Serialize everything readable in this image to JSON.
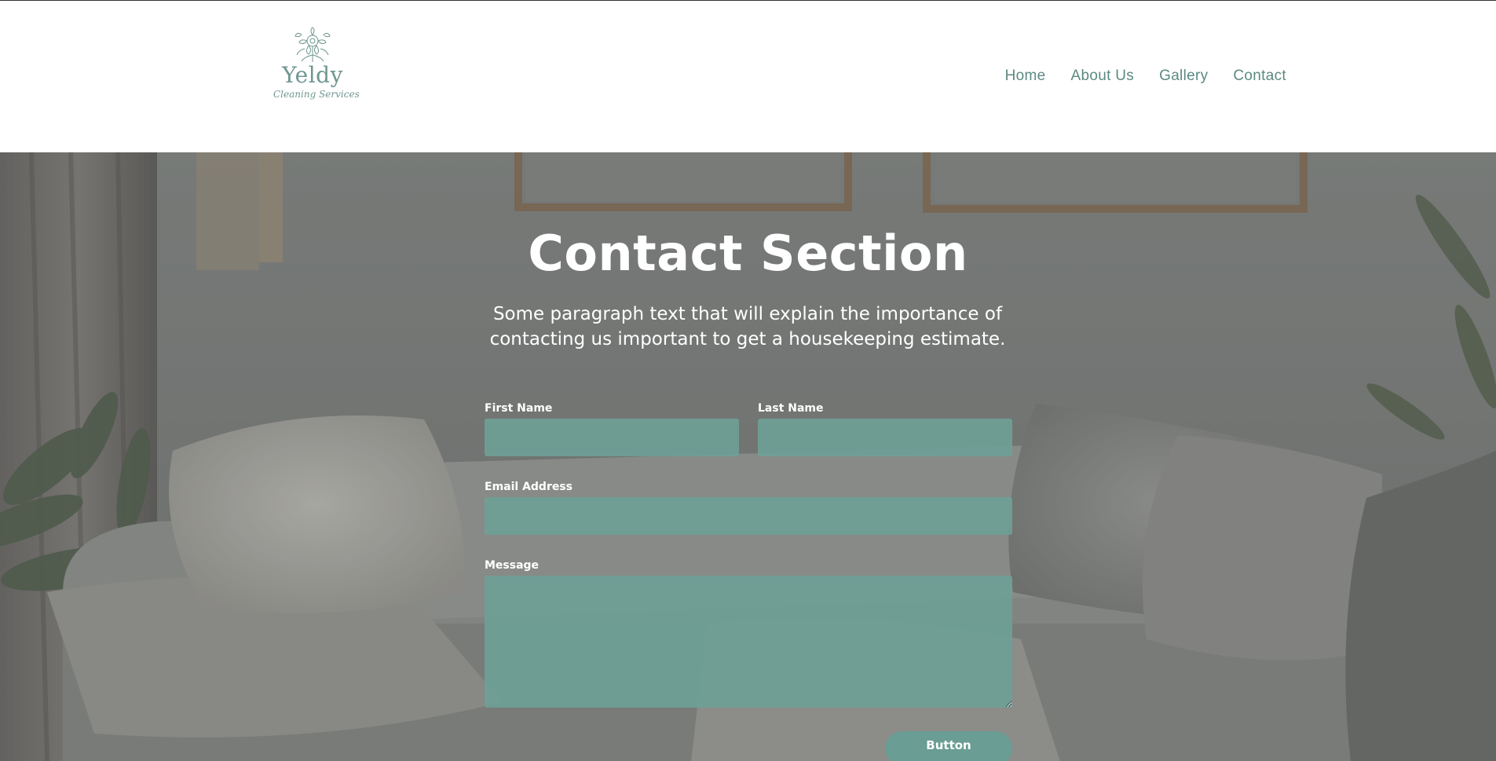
{
  "header": {
    "logo": {
      "name": "Yeldy",
      "tagline": "Cleaning Services"
    },
    "nav": [
      {
        "label": "Home"
      },
      {
        "label": "About Us"
      },
      {
        "label": "Gallery"
      },
      {
        "label": "Contact"
      }
    ]
  },
  "contact": {
    "title": "Contact Section",
    "description": "Some paragraph text that will explain the importance of contacting us important to get a housekeeping estimate.",
    "form": {
      "first_name_label": "First Name",
      "first_name_value": "",
      "last_name_label": "Last Name",
      "last_name_value": "",
      "email_label": "Email Address",
      "email_value": "",
      "message_label": "Message",
      "message_value": "",
      "submit_label": "Button"
    }
  },
  "colors": {
    "brand": "#5c8a81",
    "field_fill": "#6ea096",
    "button": "#6a9d93"
  }
}
